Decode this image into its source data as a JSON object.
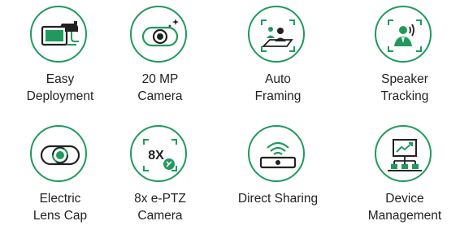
{
  "accent_color": "#1f9a5c",
  "features": [
    {
      "icon": "deployment-icon",
      "lines": [
        "Easy",
        "Deployment"
      ]
    },
    {
      "icon": "camera-icon",
      "lines": [
        "20 MP",
        "Camera"
      ]
    },
    {
      "icon": "auto-framing-icon",
      "lines": [
        "Auto",
        "Framing"
      ]
    },
    {
      "icon": "speaker-tracking-icon",
      "lines": [
        "Speaker",
        "Tracking"
      ]
    },
    {
      "icon": "lens-cap-icon",
      "lines": [
        "Electric",
        "Lens Cap"
      ]
    },
    {
      "icon": "zoom-8x-icon",
      "lines": [
        "8x e-PTZ",
        "Camera"
      ],
      "icon_text": "8X"
    },
    {
      "icon": "direct-sharing-icon",
      "lines": [
        "Direct Sharing"
      ]
    },
    {
      "icon": "device-management-icon",
      "lines": [
        "Device",
        "Management"
      ]
    }
  ]
}
